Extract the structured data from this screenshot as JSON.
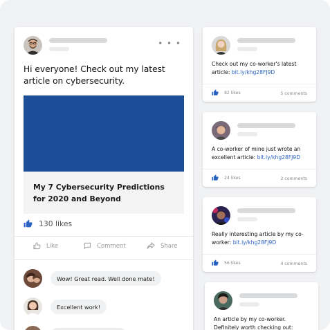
{
  "colors": {
    "accent": "#2b63c4",
    "article_banner": "#1b4e96",
    "skeleton": "#d9dadc",
    "background": "#f1f2f4"
  },
  "main_post": {
    "more_icon": "more-horizontal-icon",
    "text": "Hi everyone! Check out my latest article on cybersecurity.",
    "article_title": "My 7 Cybersecurity Predictions for 2020 and Beyond",
    "likes": "130 likes",
    "actions": {
      "like": "Like",
      "comment": "Comment",
      "share": "Share"
    },
    "comments": [
      {
        "text": "Wow! Great read. Well done mate!"
      },
      {
        "text": "Excellent work!"
      }
    ]
  },
  "feed": [
    {
      "text": "Check out my co-worker's latest article: ",
      "link": "bit.ly/khg28FJ9D",
      "likes": "82 likes",
      "comments": "5 comments"
    },
    {
      "text": "A co-worker of mine just wrote an excellent article: ",
      "link": "bit.ly/khg28FJ9D",
      "likes": "24 likes",
      "comments": "2 comments"
    },
    {
      "text": "Really interesting article by my co-worker: ",
      "link": "bit.ly/khg28FJ9D",
      "likes": "56 likes",
      "comments": "4 comments"
    },
    {
      "text": "An article by my co-worker. Definitely worth checking out:"
    }
  ]
}
